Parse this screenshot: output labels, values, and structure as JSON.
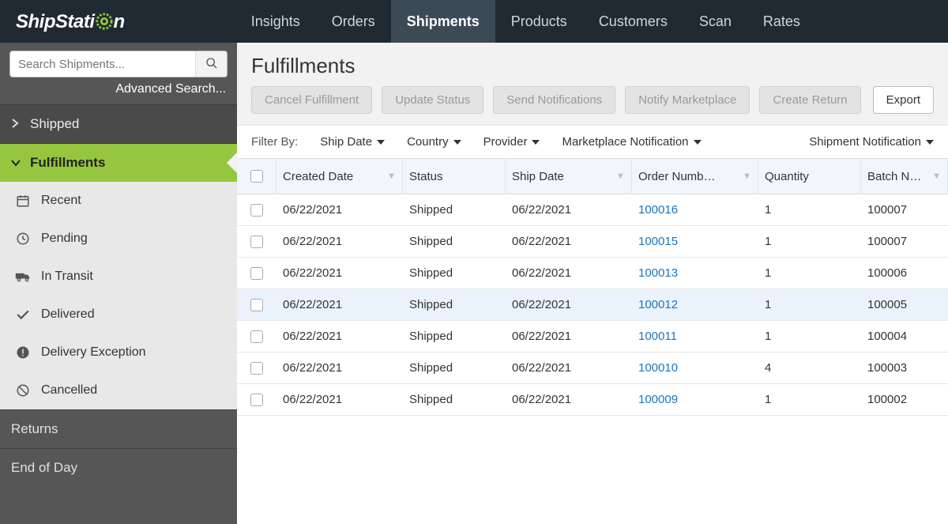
{
  "brand": {
    "part1": "ShipStati",
    "part2": "n"
  },
  "nav": {
    "insights": "Insights",
    "orders": "Orders",
    "shipments": "Shipments",
    "products": "Products",
    "customers": "Customers",
    "scan": "Scan",
    "rates": "Rates"
  },
  "search": {
    "placeholder": "Search Shipments...",
    "advanced": "Advanced Search..."
  },
  "sidebar": {
    "shipped": "Shipped",
    "fulfillments": "Fulfillments",
    "items": [
      {
        "label": "Recent"
      },
      {
        "label": "Pending"
      },
      {
        "label": "In Transit"
      },
      {
        "label": "Delivered"
      },
      {
        "label": "Delivery Exception"
      },
      {
        "label": "Cancelled"
      }
    ],
    "returns": "Returns",
    "eod": "End of Day"
  },
  "page": {
    "title": "Fulfillments"
  },
  "actions": {
    "cancel": "Cancel Fulfillment",
    "update": "Update Status",
    "send": "Send Notifications",
    "notify": "Notify Marketplace",
    "return": "Create Return",
    "export": "Export"
  },
  "filters": {
    "label": "Filter By:",
    "shipdate": "Ship Date",
    "country": "Country",
    "provider": "Provider",
    "marketplace": "Marketplace Notification",
    "shipment": "Shipment Notification"
  },
  "columns": {
    "created": "Created Date",
    "status": "Status",
    "ship": "Ship Date",
    "order": "Order Numb…",
    "qty": "Quantity",
    "batch": "Batch N…"
  },
  "rows": [
    {
      "created": "06/22/2021",
      "status": "Shipped",
      "ship": "06/22/2021",
      "order": "100016",
      "qty": "1",
      "batch": "100007"
    },
    {
      "created": "06/22/2021",
      "status": "Shipped",
      "ship": "06/22/2021",
      "order": "100015",
      "qty": "1",
      "batch": "100007"
    },
    {
      "created": "06/22/2021",
      "status": "Shipped",
      "ship": "06/22/2021",
      "order": "100013",
      "qty": "1",
      "batch": "100006"
    },
    {
      "created": "06/22/2021",
      "status": "Shipped",
      "ship": "06/22/2021",
      "order": "100012",
      "qty": "1",
      "batch": "100005"
    },
    {
      "created": "06/22/2021",
      "status": "Shipped",
      "ship": "06/22/2021",
      "order": "100011",
      "qty": "1",
      "batch": "100004"
    },
    {
      "created": "06/22/2021",
      "status": "Shipped",
      "ship": "06/22/2021",
      "order": "100010",
      "qty": "4",
      "batch": "100003"
    },
    {
      "created": "06/22/2021",
      "status": "Shipped",
      "ship": "06/22/2021",
      "order": "100009",
      "qty": "1",
      "batch": "100002"
    }
  ]
}
